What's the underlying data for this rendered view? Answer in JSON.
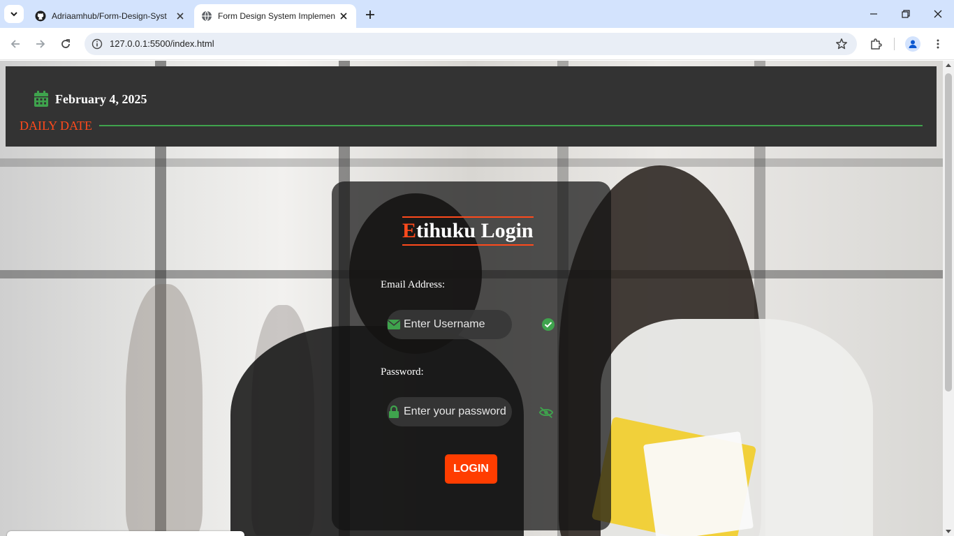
{
  "browser": {
    "tabs": [
      {
        "title": "Adriaamhub/Form-Design-Syst",
        "icon": "github-icon",
        "active": false
      },
      {
        "title": "Form Design System Implement",
        "icon": "globe-icon",
        "active": true
      }
    ],
    "url": "127.0.0.1:5500/index.html"
  },
  "header": {
    "date": "February 4, 2025",
    "section_label": "DAILY DATE"
  },
  "login": {
    "title_first_letter": "E",
    "title_rest": "tihuku Login",
    "email_label": "Email Address:",
    "email_placeholder": "Enter Username",
    "password_label": "Password:",
    "password_placeholder": "Enter your password",
    "button_label": "LOGIN"
  },
  "colors": {
    "accent": "#ff4a1c",
    "green": "#3fa34d",
    "header_bg": "#333333"
  }
}
